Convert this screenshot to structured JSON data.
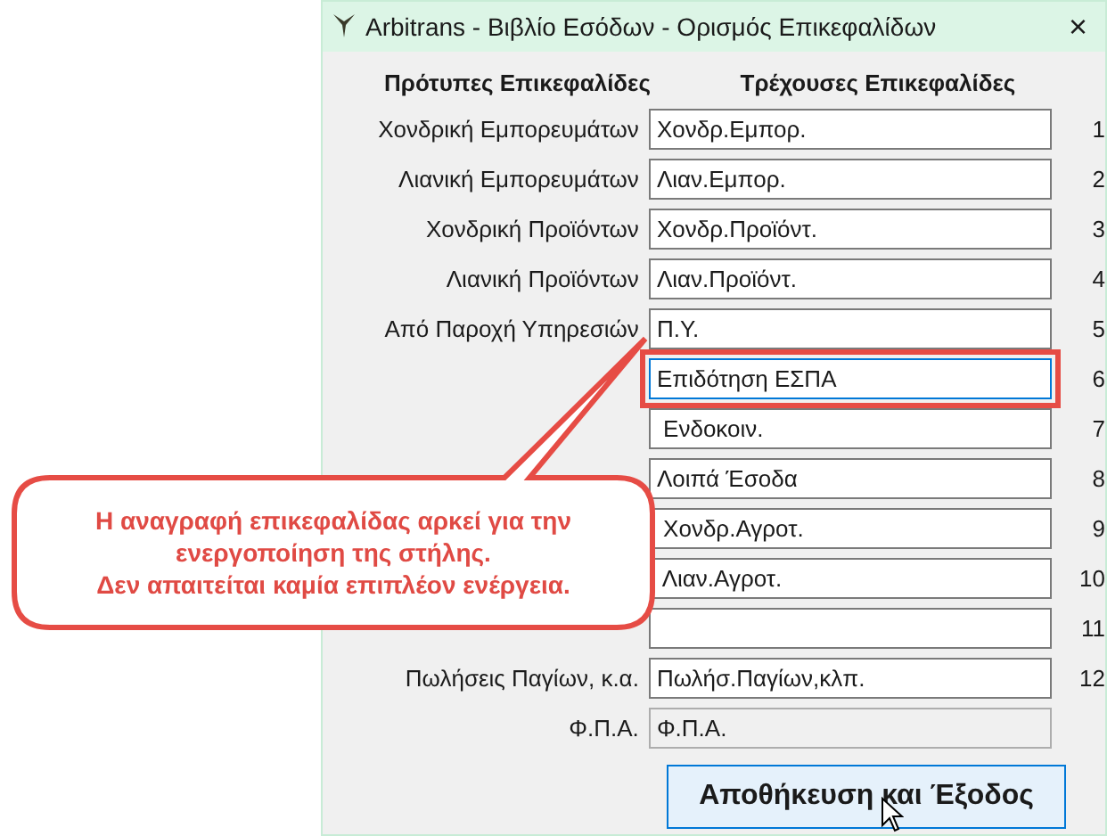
{
  "window": {
    "title": "Arbitrans - Βιβλίο Εσόδων - Ορισμός Επικεφαλίδων",
    "close": "×"
  },
  "headers": {
    "standard": "Πρότυπες Επικεφαλίδες",
    "current": "Τρέχουσες Επικεφαλίδες"
  },
  "rows": [
    {
      "label": "Χονδρική Εμπορευμάτων",
      "value": "Χονδρ.Εμπορ.",
      "number": "1",
      "focused": false,
      "disabled": false,
      "highlighted": false
    },
    {
      "label": "Λιανική Εμπορευμάτων",
      "value": "Λιαν.Εμπορ.",
      "number": "2",
      "focused": false,
      "disabled": false,
      "highlighted": false
    },
    {
      "label": "Χονδρική Προϊόντων",
      "value": "Χονδρ.Προϊόντ.",
      "number": "3",
      "focused": false,
      "disabled": false,
      "highlighted": false
    },
    {
      "label": "Λιανική Προϊόντων",
      "value": "Λιαν.Προϊόντ.",
      "number": "4",
      "focused": false,
      "disabled": false,
      "highlighted": false
    },
    {
      "label": "Από Παροχή Υπηρεσιών",
      "value": "Π.Υ.",
      "number": "5",
      "focused": false,
      "disabled": false,
      "highlighted": false
    },
    {
      "value": "Επιδότηση ΕΣΠΑ",
      "number": "6",
      "focused": true,
      "disabled": false,
      "highlighted": true
    },
    {
      "value": " Ενδοκοιν.",
      "number": "7",
      "focused": false,
      "disabled": false,
      "highlighted": false
    },
    {
      "value": "Λοιπά Έσοδα",
      "number": "8",
      "focused": false,
      "disabled": false,
      "highlighted": false
    },
    {
      "value": " Χονδρ.Αγροτ.",
      "number": "9",
      "focused": false,
      "disabled": false,
      "highlighted": false
    },
    {
      "value": " Λιαν.Αγροτ.",
      "number": "10",
      "focused": false,
      "disabled": false,
      "highlighted": false
    },
    {
      "number": "11",
      "focused": false,
      "disabled": false,
      "highlighted": false
    },
    {
      "label": "Πωλήσεις Παγίων, κ.α.",
      "value": "Πωλήσ.Παγίων,κλπ.",
      "number": "12",
      "focused": false,
      "disabled": false,
      "highlighted": false
    },
    {
      "label": "Φ.Π.Α.",
      "value": "Φ.Π.Α.",
      "focused": false,
      "disabled": true,
      "highlighted": false
    }
  ],
  "save_button": "Αποθήκευση και Έξοδος",
  "callout": {
    "text": "Η αναγραφή επικεφαλίδας αρκεί για την\nενεργοποίηση της στήλης.\nΔεν απαιτείται καμία επιπλέον ενέργεια."
  }
}
